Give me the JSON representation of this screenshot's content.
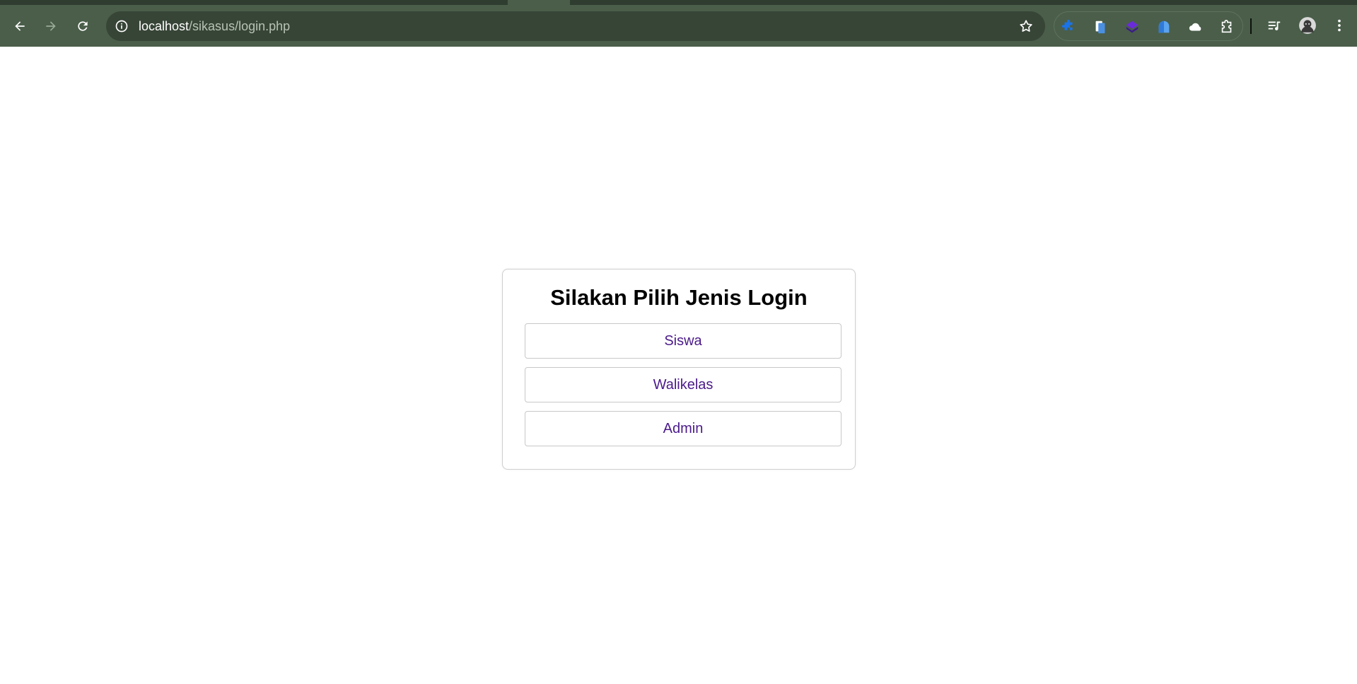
{
  "browser": {
    "url_host": "localhost",
    "url_path": "/sikasus/login.php",
    "colors": {
      "toolbar": "#4a5e4a",
      "tabstrip": "#2f3d31",
      "omnibox": "#374537"
    },
    "nav_icons": [
      "back-arrow-icon",
      "forward-arrow-icon",
      "reload-icon"
    ],
    "extension_icons": [
      "puzzle-extension-icon",
      "document-extension-icon",
      "layers-extension-icon",
      "ghost-extension-icon",
      "cloud-extension-icon",
      "extensions-menu-icon"
    ],
    "right_icons": [
      "media-queue-icon",
      "profile-avatar-icon",
      "more-menu-icon"
    ]
  },
  "login": {
    "title": "Silakan Pilih Jenis Login",
    "options": [
      {
        "label": "Siswa"
      },
      {
        "label": "Walikelas"
      },
      {
        "label": "Admin"
      }
    ],
    "link_color": "#4b1a8a"
  }
}
